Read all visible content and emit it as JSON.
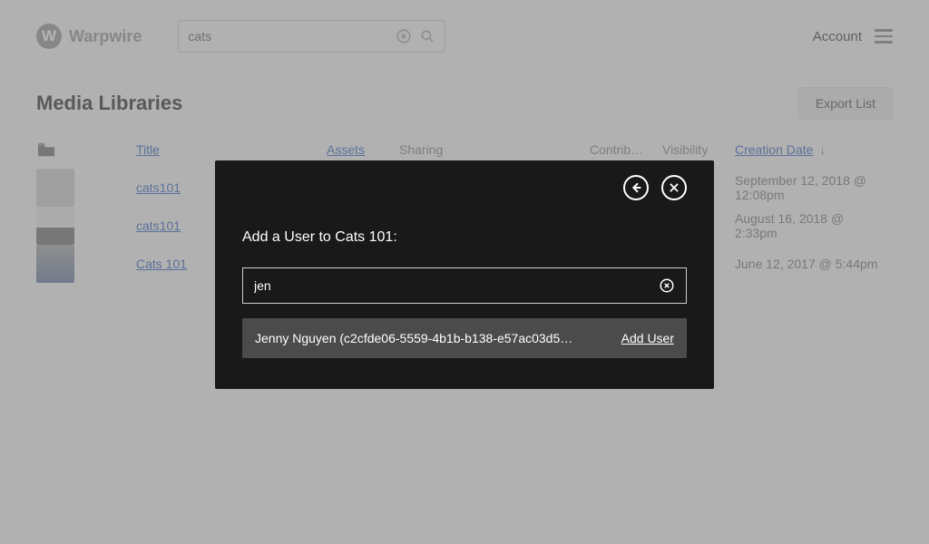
{
  "brand": "Warpwire",
  "search": {
    "value": "cats"
  },
  "account_label": "Account",
  "page_title": "Media Libraries",
  "export_label": "Export List",
  "columns": {
    "title": "Title",
    "assets": "Assets",
    "sharing": "Sharing",
    "contrib": "Contrib…",
    "visibility": "Visibility",
    "creation_date": "Creation Date",
    "sort_icon": "↓"
  },
  "rows": [
    {
      "title": "cats101",
      "date": "September 12, 2018 @ 12:08pm"
    },
    {
      "title": "cats101",
      "date": "August 16, 2018 @ 2:33pm"
    },
    {
      "title": "Cats 101",
      "date": "June 12, 2017 @ 5:44pm"
    }
  ],
  "modal": {
    "title": "Add a User to Cats 101:",
    "input_value": "jen",
    "result": {
      "label": "Jenny Nguyen (c2cfde06-5559-4b1b-b138-e57ac03d5…",
      "add_label": "Add User"
    }
  }
}
